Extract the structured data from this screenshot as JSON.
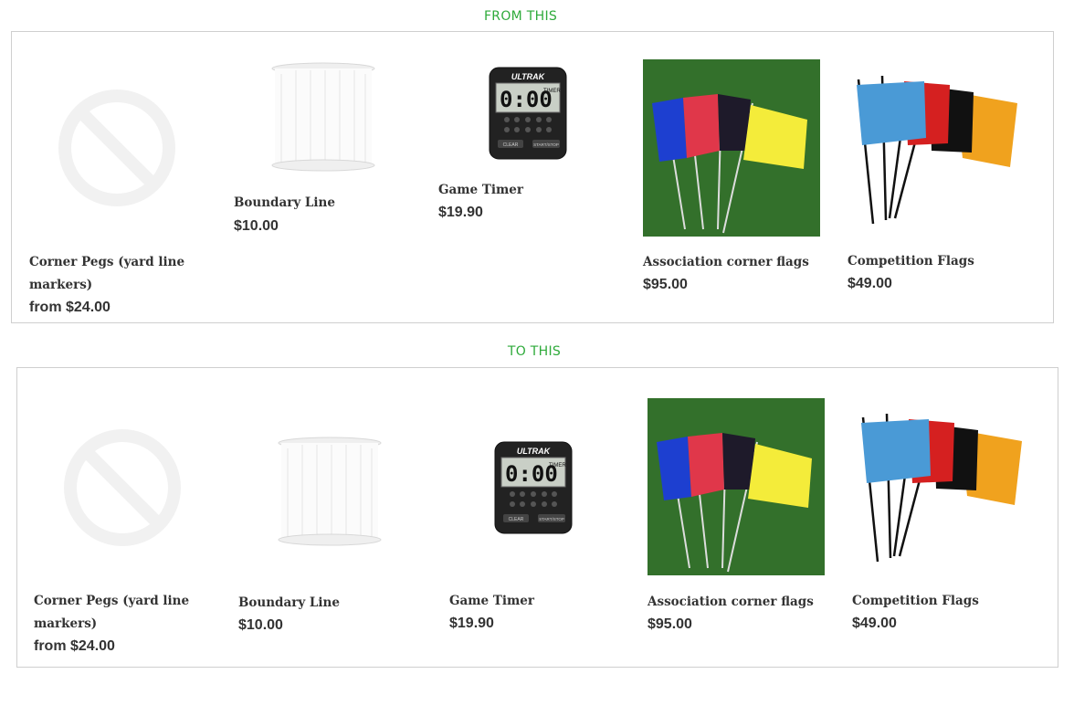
{
  "sections": [
    {
      "title": "FROM THIS",
      "products": [
        {
          "name": "Corner Pegs (yard line markers)",
          "price": "from $24.00",
          "image": "no-image-placeholder"
        },
        {
          "name": "Boundary Line",
          "price": "$10.00",
          "image": "white-rope-spool"
        },
        {
          "name": "Game Timer",
          "price": "$19.90",
          "image": "digital-timer"
        },
        {
          "name": "Association corner flags",
          "price": "$95.00",
          "image": "colored-flags-on-grass"
        },
        {
          "name": "Competition Flags",
          "price": "$49.00",
          "image": "colored-flags"
        }
      ]
    },
    {
      "title": "TO THIS",
      "products": [
        {
          "name": "Corner Pegs (yard line markers)",
          "price": "from $24.00",
          "image": "no-image-placeholder"
        },
        {
          "name": "Boundary Line",
          "price": "$10.00",
          "image": "white-rope-spool"
        },
        {
          "name": "Game Timer",
          "price": "$19.90",
          "image": "digital-timer"
        },
        {
          "name": "Association corner flags",
          "price": "$95.00",
          "image": "colored-flags-on-grass"
        },
        {
          "name": "Competition Flags",
          "price": "$49.00",
          "image": "colored-flags"
        }
      ]
    }
  ],
  "timer": {
    "brand": "ULTRAK",
    "display": "0:00",
    "label": "TIMER",
    "left_button": "CLEAR",
    "right_button": "START/STOP"
  },
  "colors": {
    "accent": "#2eaa3a",
    "flag_blue": "#1d3fd0",
    "flag_red": "#e0374a",
    "flag_black": "#1e1a2a",
    "flag_yellow": "#f4ec3a",
    "grass": "#2f6a28",
    "comp_blue": "#4a9ad6",
    "comp_red": "#d52020",
    "comp_orange": "#f0a21e"
  }
}
